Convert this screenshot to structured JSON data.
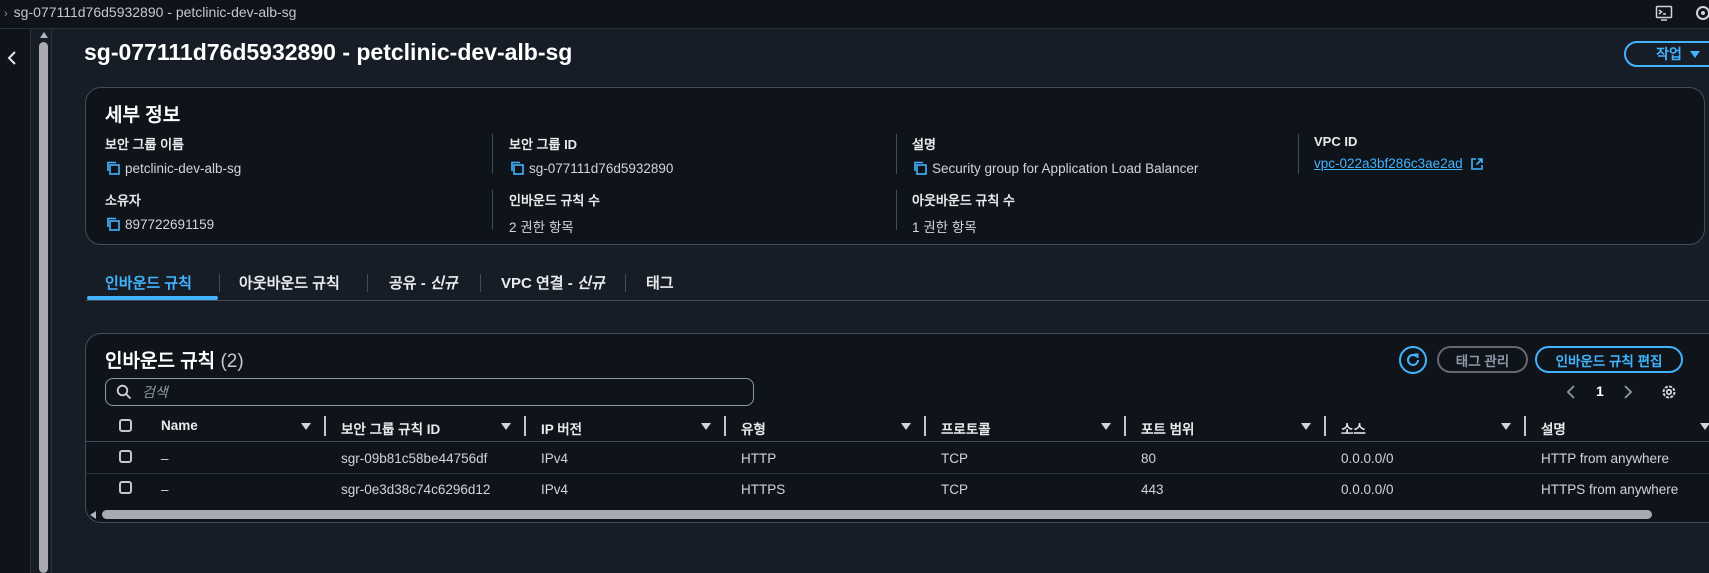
{
  "window": {
    "title": "sg-077111d76d5932890 - petclinic-dev-alb-sg"
  },
  "page": {
    "title": "sg-077111d76d5932890 - petclinic-dev-alb-sg",
    "actions_label": "작업"
  },
  "details": {
    "title": "세부 정보",
    "fields": [
      {
        "label": "보안 그룹 이름",
        "value": "petclinic-dev-alb-sg",
        "copyable": true
      },
      {
        "label": "보안 그룹 ID",
        "value": "sg-077111d76d5932890",
        "copyable": true
      },
      {
        "label": "설명",
        "value": "Security group for Application Load Balancer",
        "copyable": true
      },
      {
        "label": "VPC ID",
        "value": "vpc-022a3bf286c3ae2ad",
        "link": true
      },
      {
        "label": "소유자",
        "value": "897722691159",
        "copyable": true
      },
      {
        "label": "인바운드 규칙 수",
        "value": "2 권한 항목"
      },
      {
        "label": "아웃바운드 규칙 수",
        "value": "1 권한 항목"
      }
    ]
  },
  "tabs": [
    {
      "label": "인바운드 규칙",
      "active": true
    },
    {
      "label": "아웃바운드 규칙"
    },
    {
      "label": "공유 - ",
      "tag": "신규"
    },
    {
      "label": "VPC 연결 - ",
      "tag": "신규"
    },
    {
      "label": "태그"
    }
  ],
  "rules": {
    "title": "인바운드 규칙",
    "count": "(2)",
    "manage_tags_label": "태그 관리",
    "edit_label": "인바운드 규칙 편집",
    "search_placeholder": "검색",
    "page": "1",
    "columns": [
      "Name",
      "보안 그룹 규칙 ID",
      "IP 버전",
      "유형",
      "프로토콜",
      "포트 범위",
      "소스",
      "설명"
    ],
    "rows": [
      [
        "–",
        "sgr-09b81c58be44756df",
        "IPv4",
        "HTTP",
        "TCP",
        "80",
        "0.0.0.0/0",
        "HTTP from anywhere"
      ],
      [
        "–",
        "sgr-0e3d38c74c6296d12",
        "IPv4",
        "HTTPS",
        "TCP",
        "443",
        "0.0.0.0/0",
        "HTTPS from anywhere"
      ]
    ]
  },
  "colors": {
    "background": "#161d26",
    "card": "#0f141a",
    "accent": "#42b4ff",
    "border": "#414d5c"
  },
  "icons": [
    "chevron-left-icon",
    "copy-icon",
    "external-link-icon",
    "refresh-icon",
    "search-icon",
    "settings-gear-icon",
    "sort-caret-icon",
    "caret-down-icon"
  ]
}
